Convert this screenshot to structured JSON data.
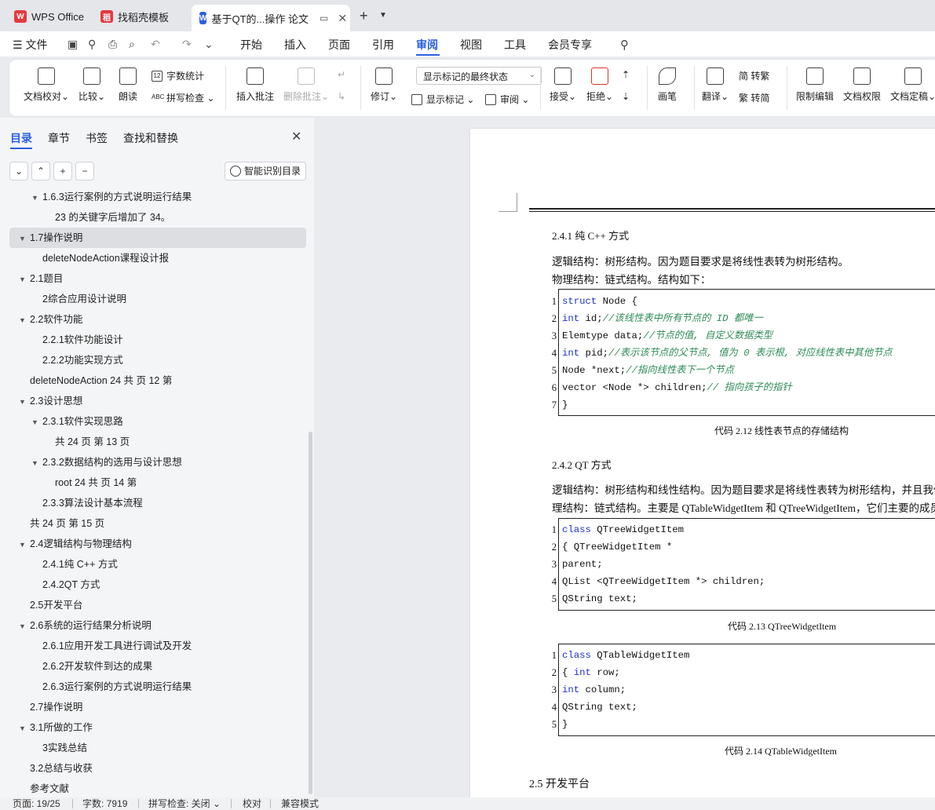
{
  "tabs": [
    {
      "label": "WPS Office",
      "logo": "W"
    },
    {
      "label": "找稻壳模板",
      "logo": "稻"
    },
    {
      "label": "基于QT的...操作 论文",
      "logo": "W"
    }
  ],
  "menu": [
    "文件",
    "开始",
    "插入",
    "页面",
    "引用",
    "审阅",
    "视图",
    "工具",
    "会员专享"
  ],
  "ribbon": {
    "proof": "文档校对",
    "compare": "比较",
    "read": "朗读",
    "wordcount": "字数统计",
    "spellcheck": "拼写检查",
    "insert_comment": "插入批注",
    "delete_comment": "删除批注",
    "revise": "修订",
    "markup_state": "显示标记的最终状态",
    "show_markup": "显示标记",
    "review": "审阅",
    "accept": "接受",
    "reject": "拒绝",
    "brush": "画笔",
    "translate": "翻译",
    "to_trad": "简 转繁",
    "to_simp": "繁 转简",
    "restrict_edit": "限制编辑",
    "doc_rights": "文档权限",
    "doc_final": "文档定稿"
  },
  "nav": {
    "tabs": [
      "目录",
      "章节",
      "书签",
      "查找和替换"
    ],
    "smart_btn": "智能识别目录",
    "items": [
      {
        "text": "1.6.3运行案例的方式说明运行结果",
        "indent": 2,
        "tri": "▼"
      },
      {
        "text": "23 的关键字后增加了 34。",
        "indent": 3,
        "tri": ""
      },
      {
        "text": "1.7操作说明",
        "indent": 1,
        "tri": "▼",
        "selected": true
      },
      {
        "text": "deleteNodeAction课程设计报",
        "indent": 2,
        "tri": ""
      },
      {
        "text": "2.1题目",
        "indent": 1,
        "tri": "▼"
      },
      {
        "text": "2综合应用设计说明",
        "indent": 2,
        "tri": ""
      },
      {
        "text": "2.2软件功能",
        "indent": 1,
        "tri": "▼"
      },
      {
        "text": "2.2.1软件功能设计",
        "indent": 2,
        "tri": ""
      },
      {
        "text": "2.2.2功能实现方式",
        "indent": 2,
        "tri": ""
      },
      {
        "text": "deleteNodeAction  24  共 页 12 第",
        "indent": 0,
        "tri": ""
      },
      {
        "text": "2.3设计思想",
        "indent": 1,
        "tri": "▼"
      },
      {
        "text": "2.3.1软件实现思路",
        "indent": 2,
        "tri": "▼"
      },
      {
        "text": "共 24  页 第 13 页",
        "indent": 3,
        "tri": ""
      },
      {
        "text": "2.3.2数据结构的选用与设计思想",
        "indent": 2,
        "tri": "▼"
      },
      {
        "text": "root  24  共 页 14 第",
        "indent": 3,
        "tri": ""
      },
      {
        "text": "2.3.3算法设计基本流程",
        "indent": 2,
        "tri": ""
      },
      {
        "text": "共 24  页 第  15 页",
        "indent": 0,
        "tri": ""
      },
      {
        "text": "2.4逻辑结构与物理结构",
        "indent": 1,
        "tri": "▼"
      },
      {
        "text": "2.4.1纯 C++ 方式",
        "indent": 2,
        "tri": ""
      },
      {
        "text": "2.4.2QT 方式",
        "indent": 2,
        "tri": ""
      },
      {
        "text": "2.5开发平台",
        "indent": 0,
        "tri": ""
      },
      {
        "text": "2.6系统的运行结果分析说明",
        "indent": 1,
        "tri": "▼"
      },
      {
        "text": "2.6.1应用开发工具进行调试及开发",
        "indent": 2,
        "tri": ""
      },
      {
        "text": "2.6.2开发软件到达的成果",
        "indent": 2,
        "tri": ""
      },
      {
        "text": "2.6.3运行案例的方式说明运行结果",
        "indent": 2,
        "tri": ""
      },
      {
        "text": "2.7操作说明",
        "indent": 0,
        "tri": ""
      },
      {
        "text": "3.1所做的工作",
        "indent": 1,
        "tri": "▼"
      },
      {
        "text": "3实践总结",
        "indent": 2,
        "tri": ""
      },
      {
        "text": "3.2总结与收获",
        "indent": 0,
        "tri": ""
      },
      {
        "text": "参考文献",
        "indent": 0,
        "tri": ""
      }
    ]
  },
  "doc": {
    "h_241": "2.4.1  纯 C++ 方式",
    "p1": "逻辑结构：树形结构。因为题目要求是将线性表转为树形结构。",
    "p2": "物理结构：链式结构。结构如下：",
    "code1": [
      [
        {
          "t": "struct",
          "c": "kw"
        },
        {
          "t": " Node {",
          "c": ""
        }
      ],
      [
        {
          "t": " int",
          "c": "kw"
        },
        {
          "t": " id;",
          "c": ""
        },
        {
          "t": "//该线性表中所有节点的 ID 都唯一",
          "c": "cm"
        }
      ],
      [
        {
          "t": " Elemtype data;",
          "c": ""
        },
        {
          "t": "//节点的值, 自定义数据类型",
          "c": "cm"
        }
      ],
      [
        {
          "t": " int",
          "c": "kw"
        },
        {
          "t": " pid;",
          "c": ""
        },
        {
          "t": "//表示该节点的父节点, 值为 0 表示根, 对应线性表中其他节点",
          "c": "cm"
        }
      ],
      [
        {
          "t": " Node *next;",
          "c": ""
        },
        {
          "t": "//指向线性表下一个节点",
          "c": "cm"
        }
      ],
      [
        {
          "t": " vector <Node *> children;",
          "c": ""
        },
        {
          "t": "// 指向孩子的指针",
          "c": "cm"
        }
      ],
      [
        {
          "t": "}",
          "c": ""
        }
      ]
    ],
    "cap1": "代码 2.12 线性表节点的存储结构",
    "h_242": "2.4.2  QT 方式",
    "p3": "逻辑结构：树形结构和线性结构。因为题目要求是将线性表转为树形结构，并且我们",
    "p4": "理结构：链式结构。主要是 QTableWidgetItem 和 QTreeWidgetItem，它们主要的成员",
    "code2": [
      [
        {
          "t": "class",
          "c": "kw"
        },
        {
          "t": " QTreeWidgetItem",
          "c": ""
        }
      ],
      [
        {
          "t": " { QTreeWidgetItem *",
          "c": ""
        }
      ],
      [
        {
          "t": " parent;",
          "c": ""
        }
      ],
      [
        {
          "t": " QList <QTreeWidgetItem *> children;",
          "c": ""
        }
      ],
      [
        {
          "t": " QString text;",
          "c": ""
        }
      ]
    ],
    "cap2": "代码 2.13 QTreeWidgetItem",
    "code3": [
      [
        {
          "t": "class",
          "c": "kw"
        },
        {
          "t": " QTableWidgetItem",
          "c": ""
        }
      ],
      [
        {
          "t": " { ",
          "c": ""
        },
        {
          "t": "int",
          "c": "kw"
        },
        {
          "t": " row;",
          "c": ""
        }
      ],
      [
        {
          "t": " int",
          "c": "kw"
        },
        {
          "t": " column;",
          "c": ""
        }
      ],
      [
        {
          "t": " QString text;",
          "c": ""
        }
      ],
      [
        {
          "t": "}",
          "c": ""
        }
      ]
    ],
    "cap3": "代码 2.14 QTableWidgetItem",
    "h_25": "2.5 开发平台"
  },
  "status": {
    "page": "页面: 19/25",
    "words": "字数: 7919",
    "spell": "拼写检查: 关闭",
    "proof": "校对",
    "compat": "兼容模式"
  }
}
